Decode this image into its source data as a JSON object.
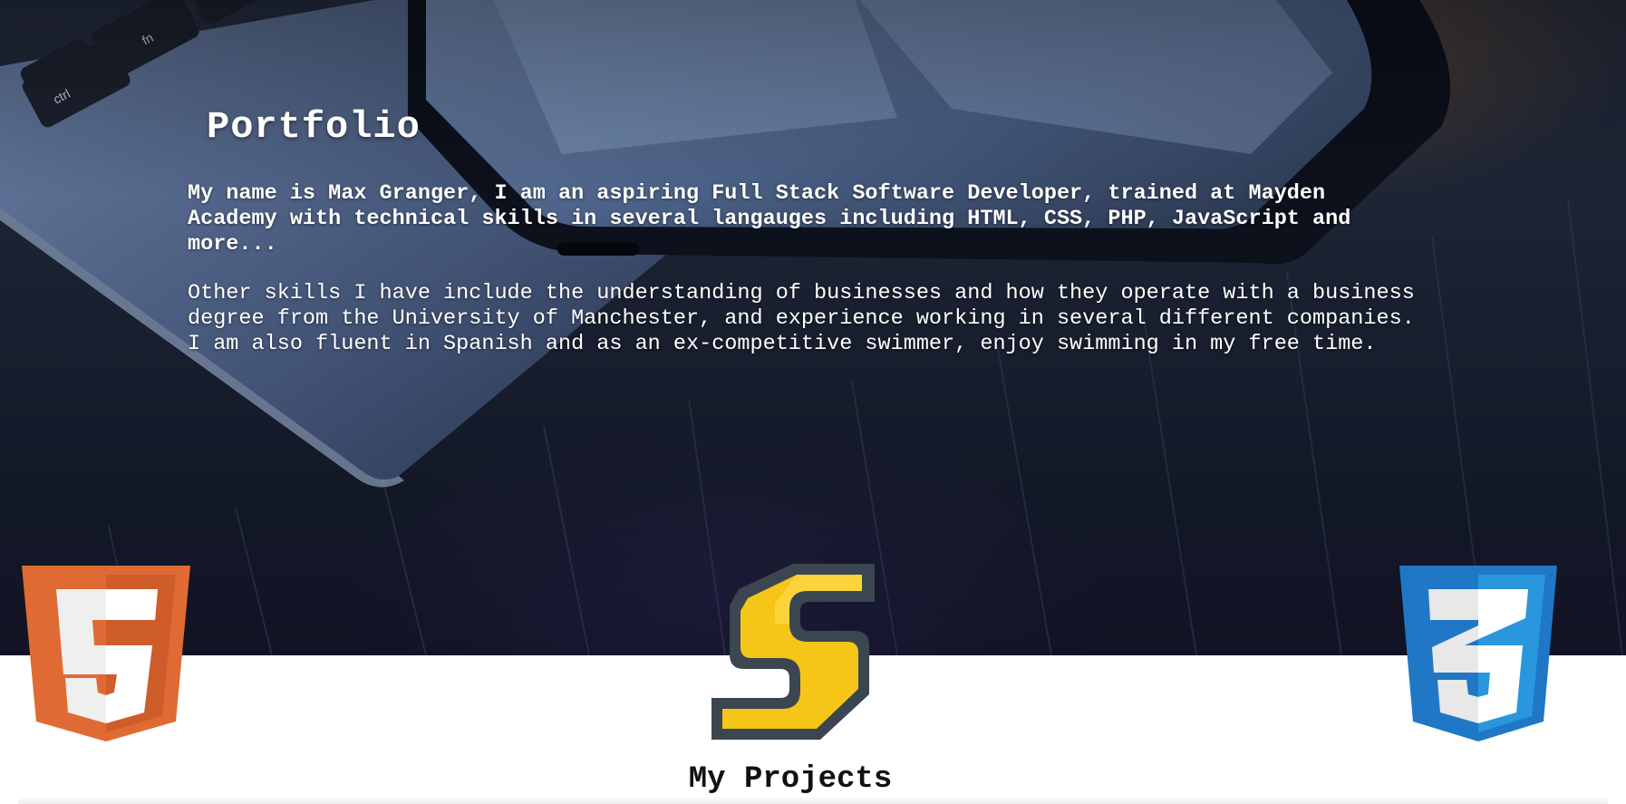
{
  "hero": {
    "title": "Portfolio",
    "intro": "My name is Max Granger, I am an aspiring Full Stack Software Developer, trained at Mayden Academy with technical skills in several langauges including HTML, CSS, PHP, JavaScript and more...",
    "about": "Other skills I have include the understanding of businesses and how they operate with a business degree from the University of Manchester, and experience working in several different companies. I am also fluent in Spanish and as an ex-competitive swimmer, enjoy swimming in my free time."
  },
  "logos": [
    {
      "icon": "html5-logo-icon",
      "color": "#e06a34"
    },
    {
      "icon": "sass-logo-icon",
      "color": "#f4c430"
    },
    {
      "icon": "css3-logo-icon",
      "color": "#1f77c6"
    }
  ],
  "keyboard": {
    "key_ctrl": "ctrl",
    "key_fn": "fn"
  },
  "projects": {
    "title": "My Projects"
  }
}
